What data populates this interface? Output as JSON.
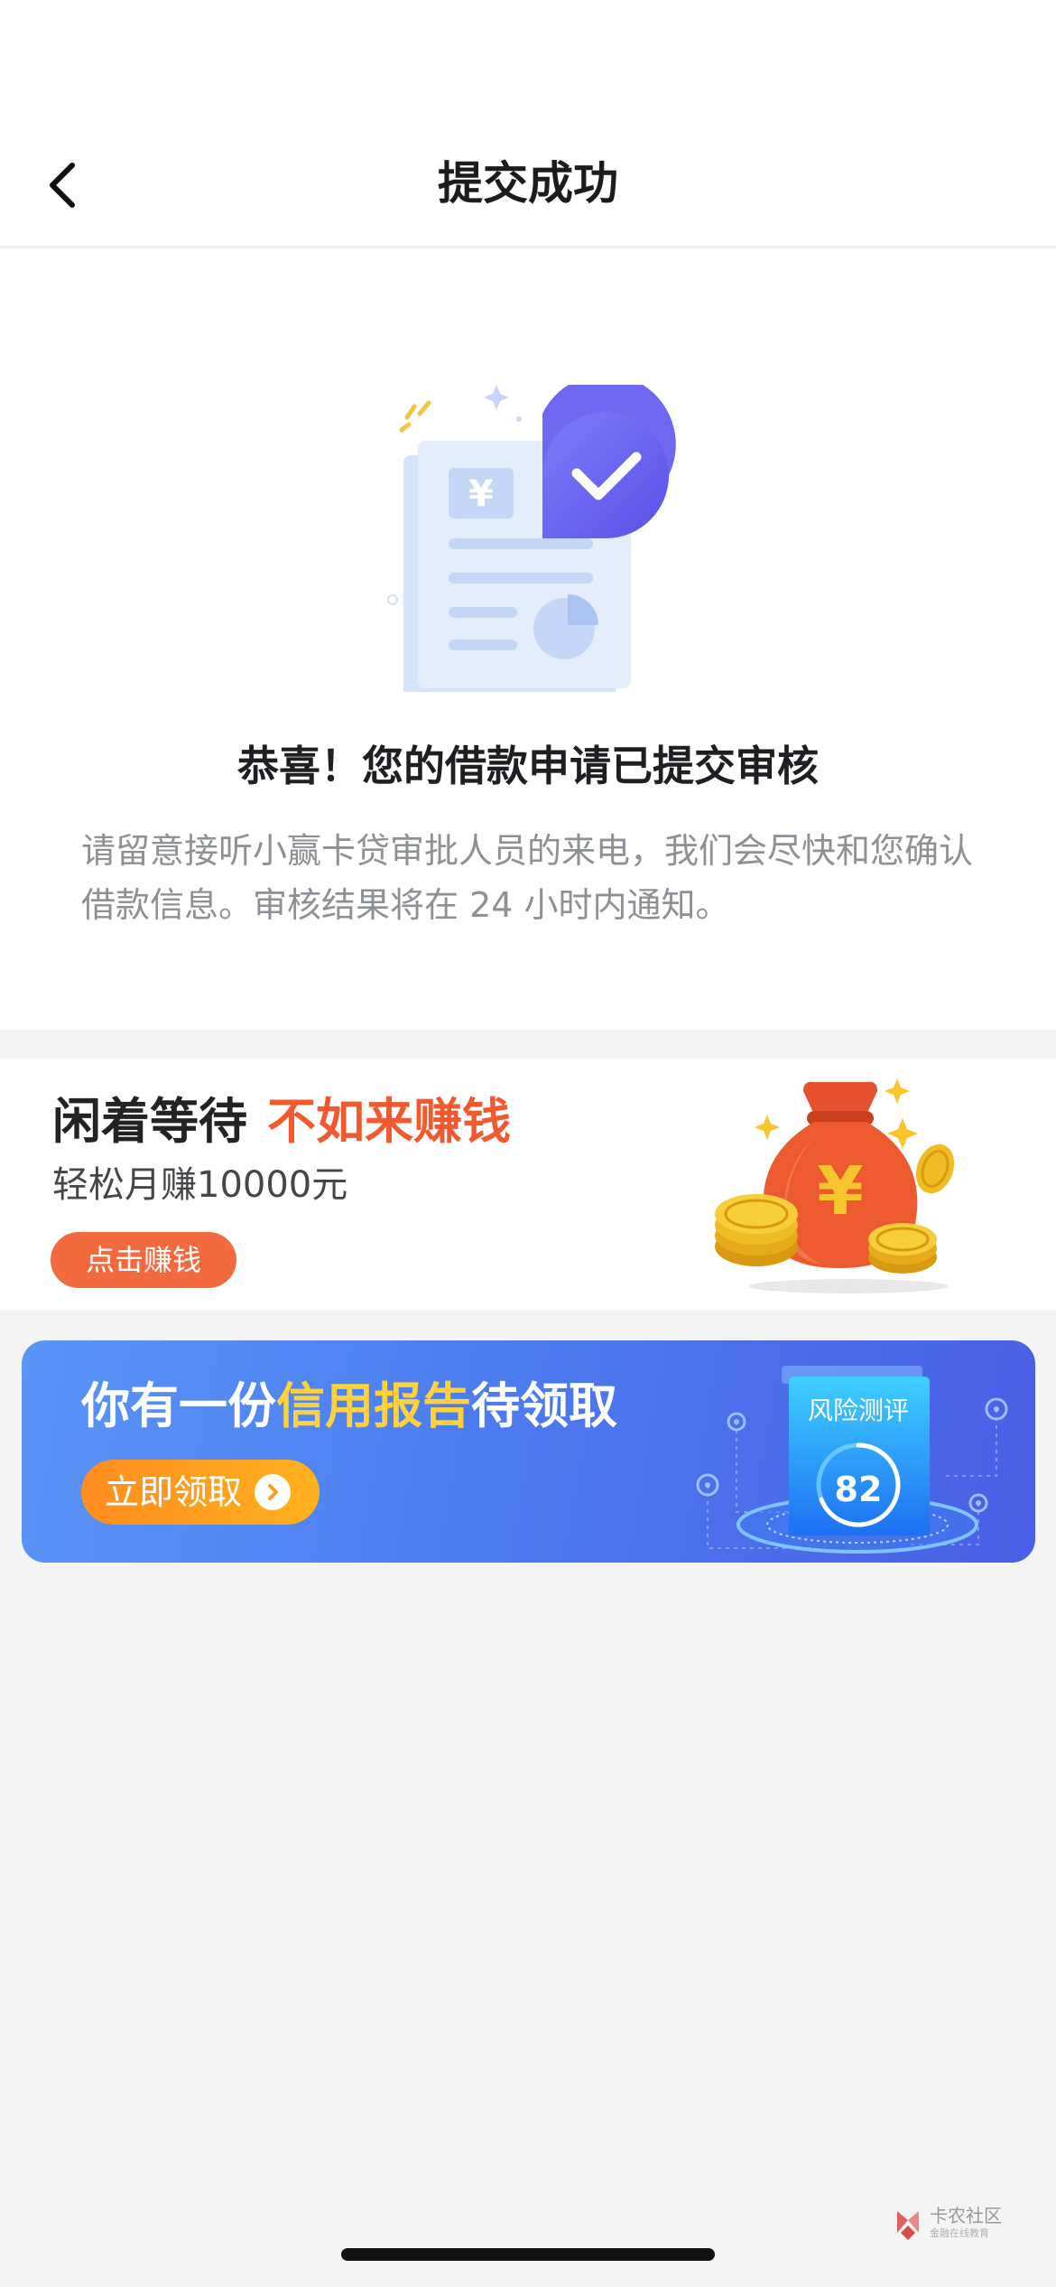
{
  "nav": {
    "title": "提交成功",
    "back_icon": "chevron-left-icon"
  },
  "success": {
    "illustration_icon": "document-check-icon",
    "title": "恭喜！您的借款申请已提交审核",
    "description": "请留意接听小赢卡贷审批人员的来电，我们会尽快和您确认借款信息。审核结果将在 24 小时内通知。"
  },
  "earn_card": {
    "title_part1": "闲着等待",
    "title_part2": "不如来赚钱",
    "subtitle": "轻松月赚10000元",
    "button_label": "点击赚钱",
    "image_icon": "money-bag-icon"
  },
  "report_banner": {
    "title_prefix": "你有一份",
    "title_highlight": "信用报告",
    "title_suffix": "待领取",
    "button_label": "立即领取",
    "risk_label": "风险测评",
    "risk_score": "82"
  },
  "watermark": {
    "name": "卡农社区",
    "sub": "金融在线教育"
  },
  "colors": {
    "accent_orange": "#f2592f",
    "banner_blue": "#4c7cf0",
    "highlight_yellow": "#ffd23c"
  }
}
